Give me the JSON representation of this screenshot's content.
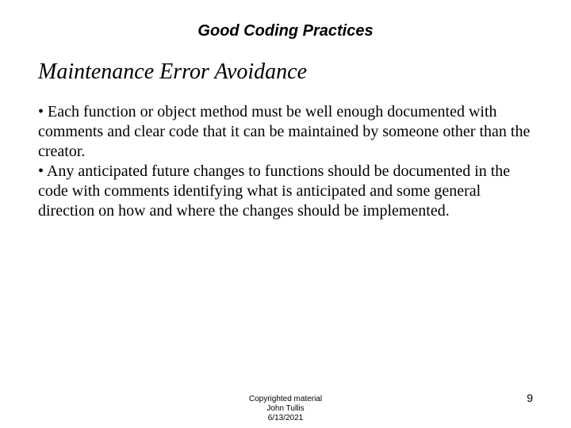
{
  "header": {
    "title": "Good Coding Practices"
  },
  "subtitle": "Maintenance Error Avoidance",
  "body": "• Each function or object method must be well enough documented with comments and clear code that it can be maintained by someone other than the creator.\n• Any anticipated future changes to functions should be documented in the code with comments identifying what is anticipated and some general direction on how and where the changes should be implemented.",
  "footer": {
    "line1": "Copyrighted material",
    "line2": "John Tullis",
    "line3": "6/13/2021"
  },
  "page_number": "9"
}
